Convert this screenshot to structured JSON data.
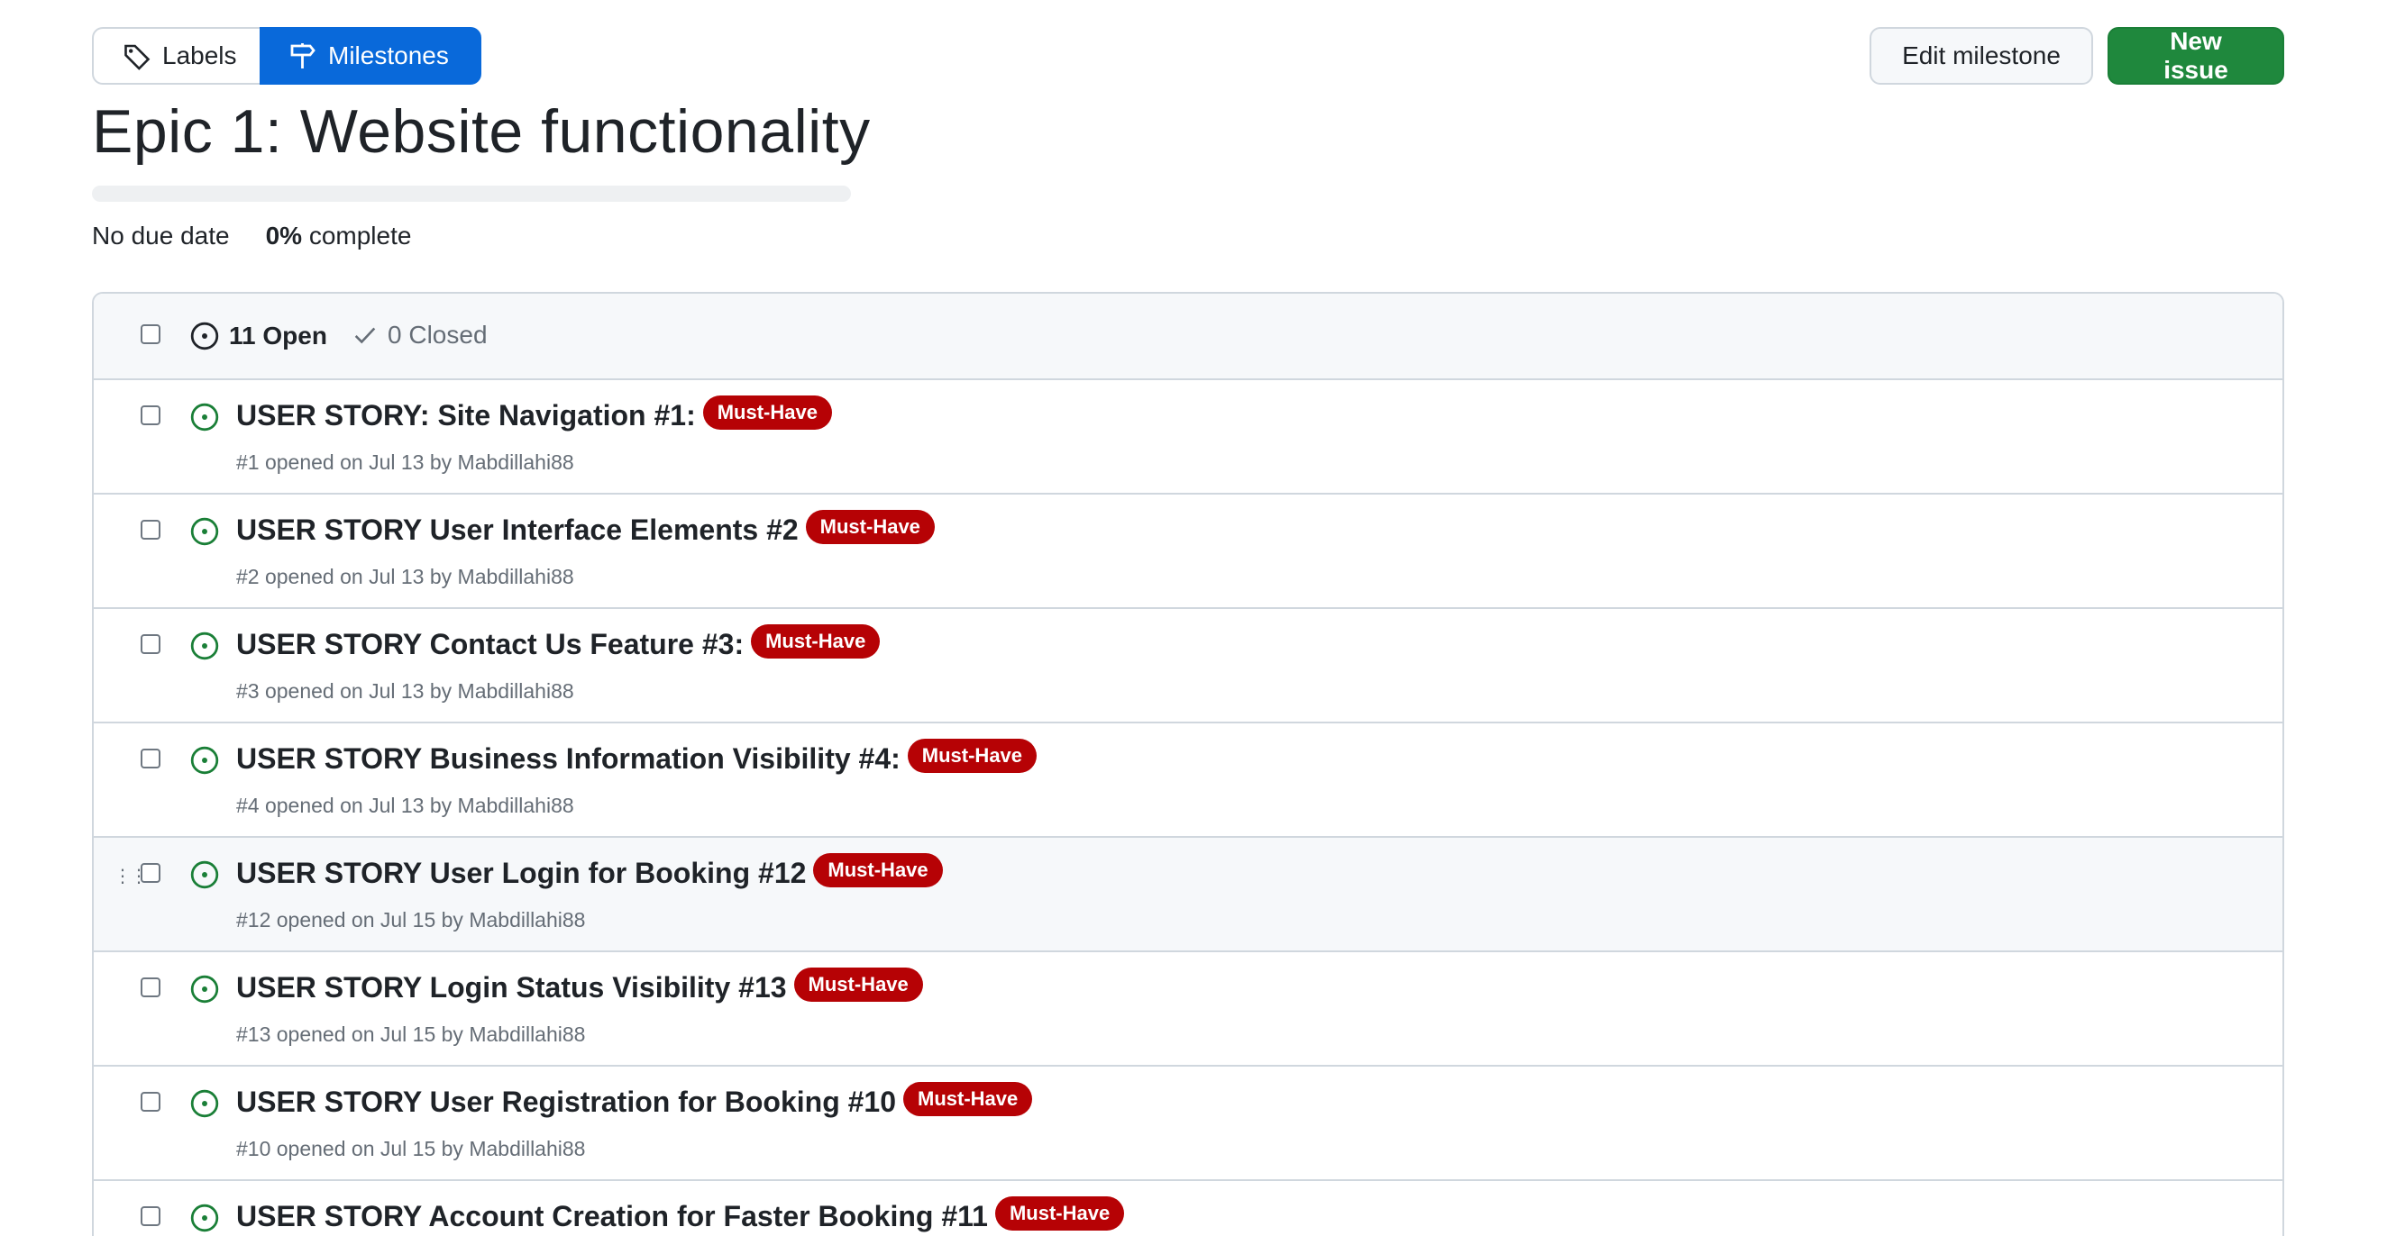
{
  "nav": {
    "labels_label": "Labels",
    "milestones_label": "Milestones"
  },
  "actions": {
    "edit_label": "Edit milestone",
    "new_issue_label": "New issue"
  },
  "milestone": {
    "title": "Epic 1: Website functionality",
    "due": "No due date",
    "percent": "0%",
    "complete_suffix": " complete",
    "progress": 0
  },
  "states": {
    "open": "11 Open",
    "closed": "0 Closed"
  },
  "issues": [
    {
      "title": "USER STORY: Site Navigation #1:",
      "label": "Must-Have",
      "meta": "#1 opened on Jul 13 by Mabdillahi88"
    },
    {
      "title": "USER STORY User Interface Elements #2",
      "label": "Must-Have",
      "meta": "#2 opened on Jul 13 by Mabdillahi88"
    },
    {
      "title": "USER STORY Contact Us Feature #3:",
      "label": "Must-Have",
      "meta": "#3 opened on Jul 13 by Mabdillahi88"
    },
    {
      "title": "USER STORY Business Information Visibility #4:",
      "label": "Must-Have",
      "meta": "#4 opened on Jul 13 by Mabdillahi88"
    },
    {
      "title": "USER STORY User Login for Booking #12",
      "label": "Must-Have",
      "meta": "#12 opened on Jul 15 by Mabdillahi88"
    },
    {
      "title": "USER STORY Login Status Visibility #13",
      "label": "Must-Have",
      "meta": "#13 opened on Jul 15 by Mabdillahi88"
    },
    {
      "title": "USER STORY User Registration for Booking #10",
      "label": "Must-Have",
      "meta": "#10 opened on Jul 15 by Mabdillahi88"
    },
    {
      "title": "USER STORY Account Creation for Faster Booking #11",
      "label": "Must-Have",
      "meta": ""
    }
  ],
  "colors": {
    "primary": "#0969da",
    "success": "#1f883d",
    "label": "#b60205",
    "open_icon": "#1a7f37"
  },
  "icons": {
    "labels": "tag-icon",
    "milestones": "milestone-icon",
    "open": "issue-opened-icon",
    "closed": "check-icon",
    "drag": "grabber-icon"
  }
}
